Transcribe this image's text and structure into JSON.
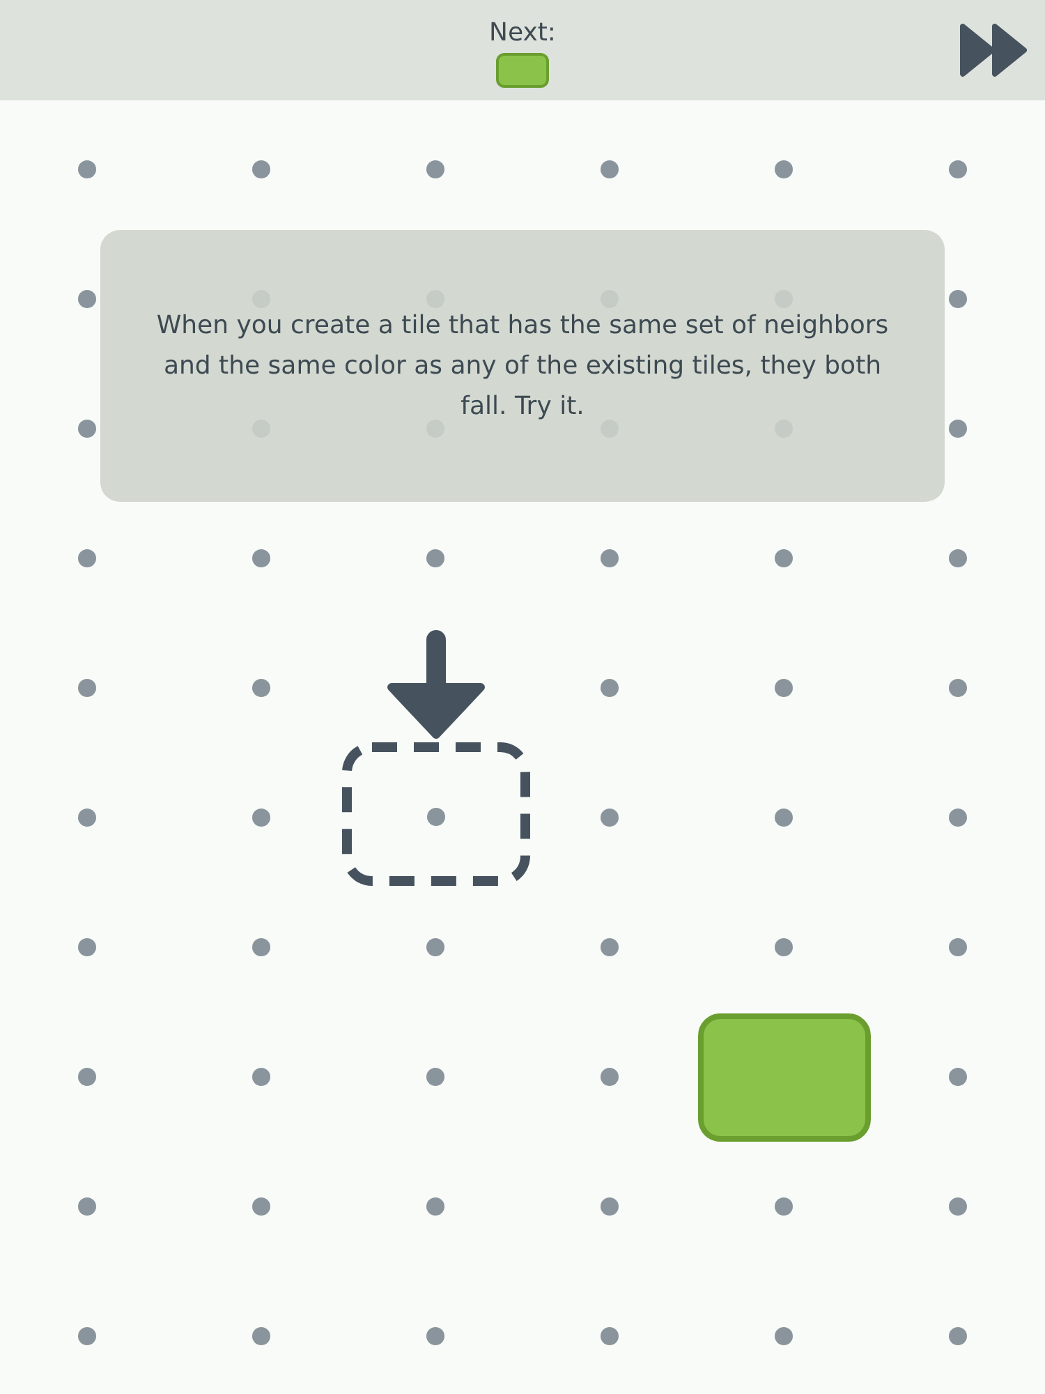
{
  "header": {
    "next_label": "Next:",
    "next_tile": {
      "color": "#8bc34a"
    }
  },
  "hint": {
    "text": "When you create a tile that has the same set of neighbors and the same color as any of the existing tiles, they both fall. Try it."
  },
  "board": {
    "rows": [
      [
        {
          "kind": "dot"
        },
        {
          "kind": "dot"
        },
        {
          "kind": "dot"
        },
        {
          "kind": "dot"
        },
        {
          "kind": "dot"
        },
        {
          "kind": "dot"
        }
      ],
      [
        {
          "kind": "dot"
        },
        {
          "kind": "dot"
        },
        {
          "kind": "dot"
        },
        {
          "kind": "dot"
        },
        {
          "kind": "dot"
        },
        {
          "kind": "dot"
        }
      ],
      [
        {
          "kind": "dot"
        },
        {
          "kind": "dot"
        },
        {
          "kind": "dot"
        },
        {
          "kind": "dot"
        },
        {
          "kind": "dot"
        },
        {
          "kind": "dot"
        }
      ],
      [
        {
          "kind": "dot"
        },
        {
          "kind": "dot"
        },
        {
          "kind": "dot"
        },
        {
          "kind": "dot"
        },
        {
          "kind": "dot"
        },
        {
          "kind": "dot"
        }
      ],
      [
        {
          "kind": "dot"
        },
        {
          "kind": "dot"
        },
        {
          "kind": "empty"
        },
        {
          "kind": "dot"
        },
        {
          "kind": "dot"
        },
        {
          "kind": "dot"
        }
      ],
      [
        {
          "kind": "dot"
        },
        {
          "kind": "dot"
        },
        {
          "kind": "target"
        },
        {
          "kind": "dot"
        },
        {
          "kind": "dot"
        },
        {
          "kind": "dot"
        }
      ],
      [
        {
          "kind": "dot"
        },
        {
          "kind": "dot"
        },
        {
          "kind": "dot"
        },
        {
          "kind": "dot"
        },
        {
          "kind": "dot"
        },
        {
          "kind": "dot"
        }
      ],
      [
        {
          "kind": "dot"
        },
        {
          "kind": "dot"
        },
        {
          "kind": "dot"
        },
        {
          "kind": "dot"
        },
        {
          "kind": "tile",
          "color": "#8bc34a"
        },
        {
          "kind": "dot"
        }
      ],
      [
        {
          "kind": "dot"
        },
        {
          "kind": "dot"
        },
        {
          "kind": "dot"
        },
        {
          "kind": "dot"
        },
        {
          "kind": "dot"
        },
        {
          "kind": "dot"
        }
      ],
      [
        {
          "kind": "dot"
        },
        {
          "kind": "dot"
        },
        {
          "kind": "dot"
        },
        {
          "kind": "dot"
        },
        {
          "kind": "dot"
        },
        {
          "kind": "dot"
        }
      ]
    ]
  }
}
